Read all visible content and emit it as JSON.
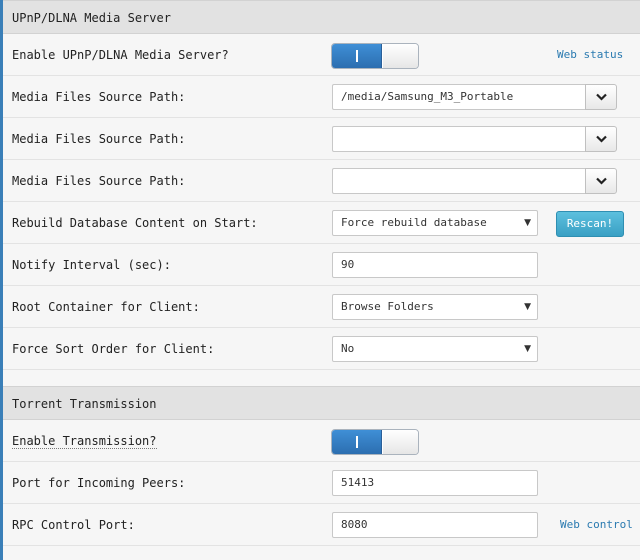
{
  "upnp": {
    "title": "UPnP/DLNA Media Server",
    "enable_label": "Enable UPnP/DLNA Media Server?",
    "web_status_link": "Web status",
    "media_path_label_1": "Media Files Source Path:",
    "media_path_value_1": "/media/Samsung_M3_Portable",
    "media_path_label_2": "Media Files Source Path:",
    "media_path_value_2": "",
    "media_path_label_3": "Media Files Source Path:",
    "media_path_value_3": "",
    "rebuild_label": "Rebuild Database Content on Start:",
    "rebuild_value": "Force rebuild database",
    "rescan_button": "Rescan!",
    "notify_label": "Notify Interval (sec):",
    "notify_value": "90",
    "root_container_label": "Root Container for Client:",
    "root_container_value": "Browse Folders",
    "sort_order_label": "Force Sort Order for Client:",
    "sort_order_value": "No",
    "enabled": true
  },
  "torrent": {
    "title": "Torrent Transmission",
    "enable_label": "Enable Transmission?",
    "enabled": true,
    "peers_port_label": "Port for Incoming Peers:",
    "peers_port_value": "51413",
    "rpc_port_label": "RPC Control Port:",
    "rpc_port_value": "8080",
    "web_control_link": "Web control"
  },
  "icons": {
    "dropdown_button": "chevron-down-icon",
    "select_caret": "caret-down-icon"
  },
  "colors": {
    "toggle_on": "#2c6eb0",
    "link": "#2a7ab0",
    "rescan_button": "#3aa0c4",
    "section_header_bg": "#e2e2e2"
  }
}
